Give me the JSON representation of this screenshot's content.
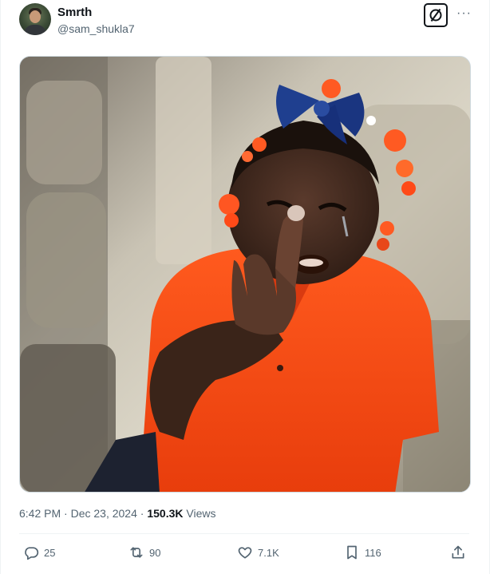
{
  "author": {
    "name": "Smrth",
    "handle": "@sam_shukla7"
  },
  "header": {
    "more_label": "···"
  },
  "meta": {
    "time": "6:42 PM",
    "sep1": "·",
    "date": "Dec 23, 2024",
    "sep2": "·",
    "views_count": "150.3K",
    "views_label": "Views"
  },
  "actions": {
    "replies": "25",
    "reposts": "90",
    "likes": "7.1K",
    "bookmarks": "116"
  },
  "colors": {
    "text": "#0f1419",
    "secondary": "#536471",
    "border": "#eff3f4",
    "shirt": "#ff4a12",
    "bow": "#1f3f8f"
  },
  "icons": [
    "grok-icon",
    "more-icon",
    "reply-icon",
    "repost-icon",
    "like-icon",
    "bookmark-icon",
    "share-icon"
  ]
}
